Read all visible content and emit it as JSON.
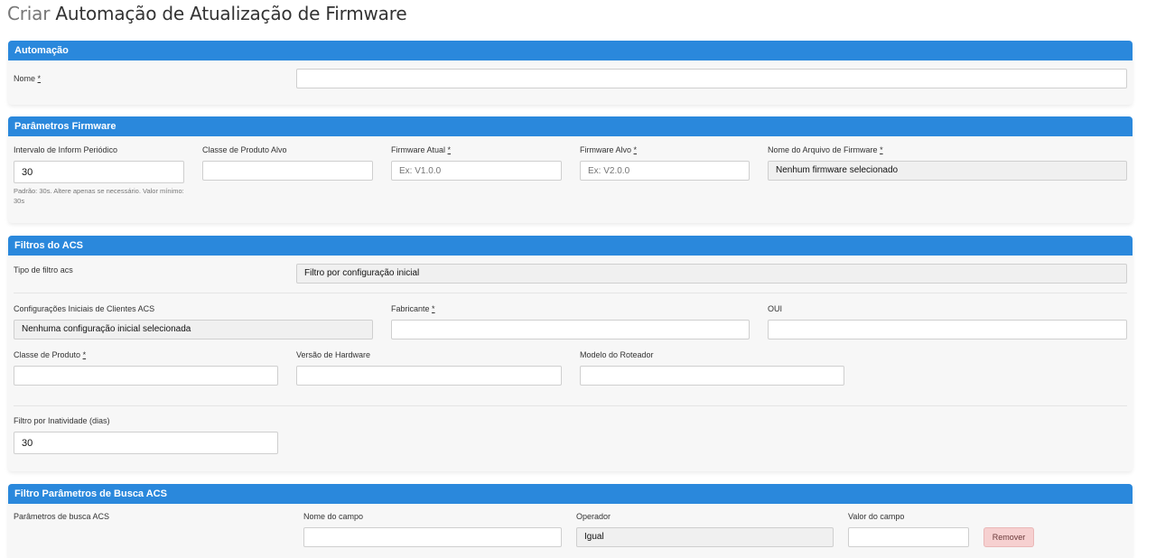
{
  "page": {
    "title_prefix": "Criar",
    "title_main": "Automação de Atualização de Firmware"
  },
  "automacao": {
    "header": "Automação",
    "nome_label": "Nome",
    "required_mark": "*",
    "nome_value": ""
  },
  "firmware": {
    "header": "Parâmetros Firmware",
    "intervalo_label": "Intervalo de Inform Periódico",
    "intervalo_value": "30",
    "intervalo_hint": "Padrão: 30s. Altere apenas se necessário. Valor mínimo: 30s",
    "classe_alvo_label": "Classe de Produto Alvo",
    "classe_alvo_value": "",
    "fw_atual_label": "Firmware Atual",
    "fw_atual_placeholder": "Ex: V1.0.0",
    "fw_alvo_label": "Firmware Alvo",
    "fw_alvo_placeholder": "Ex: V2.0.0",
    "arquivo_label": "Nome do Arquivo de Firmware",
    "arquivo_value": "Nenhum firmware selecionado"
  },
  "filtros": {
    "header": "Filtros do ACS",
    "tipo_label": "Tipo de filtro acs",
    "tipo_value": "Filtro por configuração inicial",
    "config_label": "Configurações Iniciais de Clientes ACS",
    "config_value": "Nenhuma configuração inicial selecionada",
    "fabricante_label": "Fabricante",
    "oui_label": "OUI",
    "classe_label": "Classe de Produto",
    "versao_hw_label": "Versão de Hardware",
    "modelo_label": "Modelo do Roteador",
    "inatividade_label": "Filtro por Inatividade (dias)",
    "inatividade_value": "30"
  },
  "busca": {
    "header": "Filtro Parâmetros de Busca ACS",
    "params_label": "Parâmetros de busca ACS",
    "campo_label": "Nome do campo",
    "operador_label": "Operador",
    "operador_value": "Igual",
    "valor_label": "Valor do campo",
    "remover_label": "Remover"
  }
}
